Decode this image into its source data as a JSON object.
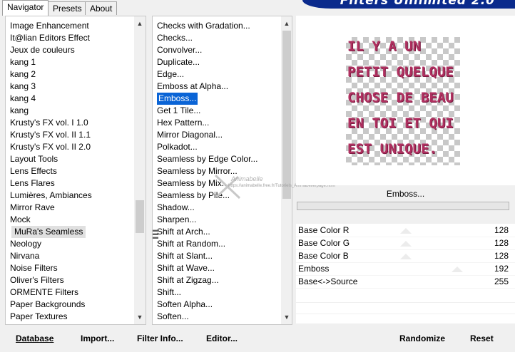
{
  "tabs": [
    "Navigator",
    "Presets",
    "About"
  ],
  "brand_title": "Filters Unlimited 2.0",
  "categories": [
    "Image Enhancement",
    "It@lian Editors Effect",
    "Jeux de couleurs",
    "kang 1",
    "kang 2",
    "kang 3",
    "kang 4",
    "kang",
    "Krusty's FX vol. I 1.0",
    "Krusty's FX vol. II 1.1",
    "Krusty's FX vol. II 2.0",
    "Layout Tools",
    "Lens Effects",
    "Lens Flares",
    "Lumières, Ambiances",
    "Mirror Rave",
    "Mock",
    "MuRa's Seamless",
    "Neology",
    "Nirvana",
    "Noise Filters",
    "Oliver's Filters",
    "ORMENTE Filters",
    "Paper Backgrounds",
    "Paper Textures"
  ],
  "selected_category": "MuRa's Seamless",
  "filters": [
    "Checks with Gradation...",
    "Checks...",
    "Convolver...",
    "Duplicate...",
    "Edge...",
    "Emboss at Alpha...",
    "Emboss...",
    "Get 1 Tile...",
    "Hex Pattern...",
    "Mirror Diagonal...",
    "Polkadot...",
    "Seamless by Edge Color...",
    "Seamless by Mirror...",
    "Seamless by Mix...",
    "Seamless by Pile...",
    "Shadow...",
    "Sharpen...",
    "Shift at Arch...",
    "Shift at Random...",
    "Shift at Slant...",
    "Shift at Wave...",
    "Shift at Zigzag...",
    "Shift...",
    "Soften Alpha...",
    "Soften..."
  ],
  "selected_filter": "Emboss...",
  "watermark": {
    "name": "Animabelle",
    "url": "https://animabelle.free.fr/Tutoriels_Animabelle/page.html"
  },
  "preview_text": [
    "IL Y A UN",
    "PETIT QUELQUE",
    "CHOSE DE BEAU",
    "EN TOI ET QUI",
    "EST UNIQUE."
  ],
  "filter_title": "Emboss...",
  "params": [
    {
      "label": "Base Color R",
      "value": "128"
    },
    {
      "label": "Base Color G",
      "value": "128"
    },
    {
      "label": "Base Color B",
      "value": "128"
    },
    {
      "label": "Emboss",
      "value": "192"
    },
    {
      "label": "Base<->Source",
      "value": "255"
    }
  ],
  "buttons": {
    "database": "Database",
    "import": "Import...",
    "filter_info": "Filter Info...",
    "editor": "Editor...",
    "randomize": "Randomize",
    "reset": "Reset"
  }
}
